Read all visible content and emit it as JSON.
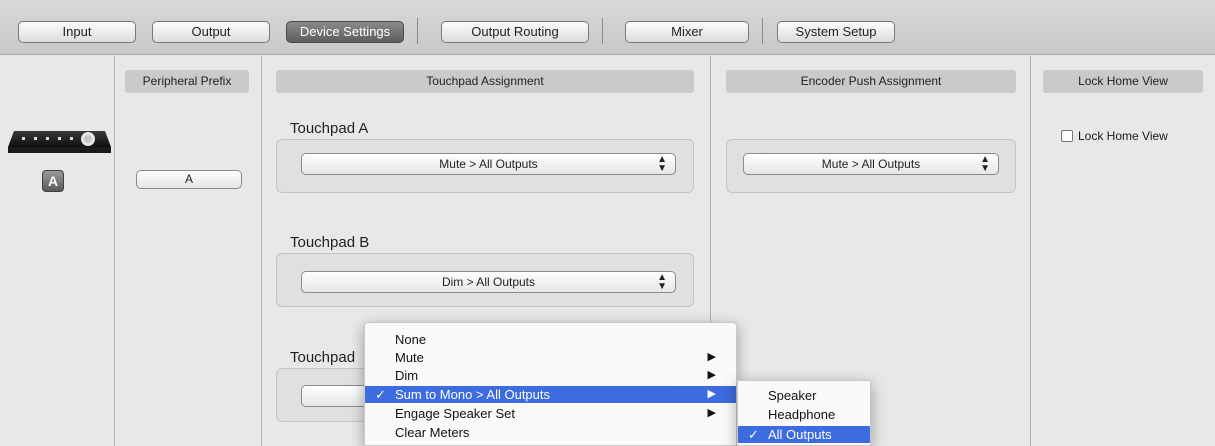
{
  "tabs": [
    {
      "label": "Input",
      "active": false
    },
    {
      "label": "Output",
      "active": false
    },
    {
      "label": "Device Settings",
      "active": true
    },
    {
      "label": "Output Routing",
      "active": false
    },
    {
      "label": "Mixer",
      "active": false
    },
    {
      "label": "System Setup",
      "active": false
    }
  ],
  "device": {
    "badge": "A"
  },
  "peripheral_prefix": {
    "header": "Peripheral Prefix",
    "value": "A"
  },
  "touchpad_assignment": {
    "header": "Touchpad Assignment",
    "touchpad_a": {
      "label": "Touchpad A",
      "value": "Mute > All Outputs"
    },
    "touchpad_b": {
      "label": "Touchpad B",
      "value": "Dim > All Outputs"
    },
    "touchpad_c": {
      "label": "Touchpad",
      "value": ""
    }
  },
  "encoder_push": {
    "header": "Encoder Push Assignment",
    "value": "Mute > All Outputs"
  },
  "lock_home_view": {
    "header": "Lock Home View",
    "checkbox_label": "Lock Home View",
    "checked": false
  },
  "context_menu": {
    "items": [
      {
        "label": "None",
        "checked": false,
        "submenu": false
      },
      {
        "label": "Mute",
        "checked": false,
        "submenu": true
      },
      {
        "label": "Dim",
        "checked": false,
        "submenu": true
      },
      {
        "label": "Sum to Mono > All Outputs",
        "checked": true,
        "submenu": true
      },
      {
        "label": "Engage Speaker Set",
        "checked": false,
        "submenu": true
      },
      {
        "label": "Clear Meters",
        "checked": false,
        "submenu": false
      }
    ],
    "check_glyph": "✓",
    "submenu_glyph": "▶"
  },
  "submenu": {
    "items": [
      {
        "label": "Speaker",
        "checked": false
      },
      {
        "label": "Headphone",
        "checked": false
      },
      {
        "label": "All Outputs",
        "checked": true
      }
    ]
  },
  "colors": {
    "selection": "#3d6be0",
    "active_tab": "#6e6e6e"
  }
}
